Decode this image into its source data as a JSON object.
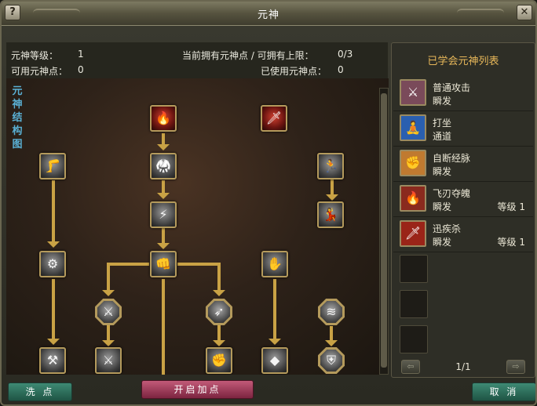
{
  "window": {
    "title": "元神",
    "help_glyph": "?",
    "close_glyph": "✕"
  },
  "info": {
    "level_label": "元神等级：",
    "level_value": "1",
    "available_label": "可用元神点：",
    "available_value": "0",
    "owned_label": "当前拥有元神点 / 可拥有上限：",
    "owned_value": "0/3",
    "used_label": "已使用元神点：",
    "used_value": "0"
  },
  "tree": {
    "side_label": "元神结构图",
    "nodes": [
      {
        "id": "n-top-fire",
        "icon": "flame-beast-icon",
        "glyph": "🔥",
        "style": "red"
      },
      {
        "id": "n-top-blade",
        "icon": "red-blade-icon",
        "glyph": "🗡",
        "style": "red"
      },
      {
        "id": "n-left-kick",
        "icon": "kick-icon",
        "glyph": "🦵",
        "style": "square"
      },
      {
        "id": "n-mid-fighter",
        "icon": "fighter-icon",
        "glyph": "🥋",
        "style": "square"
      },
      {
        "id": "n-right-runner",
        "icon": "runner-icon",
        "glyph": "🏃",
        "style": "square"
      },
      {
        "id": "n-mid-lightning",
        "icon": "lightning-icon",
        "glyph": "⚡",
        "style": "square"
      },
      {
        "id": "n-right-dancer",
        "icon": "dancer-icon",
        "glyph": "💃",
        "style": "square"
      },
      {
        "id": "n-left-ring",
        "icon": "ring-icon",
        "glyph": "⚙",
        "style": "square"
      },
      {
        "id": "n-center-strike",
        "icon": "strike-icon",
        "glyph": "👊",
        "style": "square"
      },
      {
        "id": "n-right-claw",
        "icon": "claw-icon",
        "glyph": "✋",
        "style": "square"
      },
      {
        "id": "n-oct-swords",
        "icon": "crossed-swords-icon",
        "glyph": "⚔",
        "style": "oct"
      },
      {
        "id": "n-oct-arrows",
        "icon": "arrows-icon",
        "glyph": "➶",
        "style": "oct"
      },
      {
        "id": "n-oct-wave",
        "icon": "wave-icon",
        "glyph": "≋",
        "style": "oct"
      },
      {
        "id": "n-bot-scythe",
        "icon": "scythe-icon",
        "glyph": "⚒",
        "style": "square"
      },
      {
        "id": "n-bot-blades",
        "icon": "blades-icon",
        "glyph": "⚔",
        "style": "square"
      },
      {
        "id": "n-bot-fist",
        "icon": "fist-icon",
        "glyph": "✊",
        "style": "square"
      },
      {
        "id": "n-bot-rock",
        "icon": "rock-icon",
        "glyph": "◆",
        "style": "square"
      },
      {
        "id": "n-bot-shield",
        "icon": "shield-icon",
        "glyph": "⛨",
        "style": "oct"
      }
    ]
  },
  "skills_panel": {
    "title": "已学会元神列表",
    "skills": [
      {
        "name": "普通攻击",
        "cast": "瞬发",
        "level": "",
        "icon": "crossed-blades-icon",
        "glyph": "⚔",
        "bg": "#7a4a5a"
      },
      {
        "name": "打坐",
        "cast": "通道",
        "level": "",
        "icon": "meditation-icon",
        "glyph": "🧘",
        "bg": "#2a5fb0"
      },
      {
        "name": "自断经脉",
        "cast": "瞬发",
        "level": "",
        "icon": "sacrifice-icon",
        "glyph": "✊",
        "bg": "#c07a30"
      },
      {
        "name": "飞刃夺魄",
        "cast": "瞬发",
        "level": "等级 1",
        "icon": "flying-blade-icon",
        "glyph": "🔥",
        "bg": "#8a2a1e"
      },
      {
        "name": "迅疾杀",
        "cast": "瞬发",
        "level": "等级 1",
        "icon": "swift-kill-icon",
        "glyph": "🗡",
        "bg": "#9a2418"
      }
    ],
    "page": "1/1",
    "prev_glyph": "⇦",
    "next_glyph": "⇨"
  },
  "buttons": {
    "wash": "洗 点",
    "start": "开启加点",
    "cancel": "取 消"
  },
  "colors": {
    "connector": "#c9a245",
    "accent_title": "#e8b85a",
    "side_label": "#5ab0d4"
  }
}
